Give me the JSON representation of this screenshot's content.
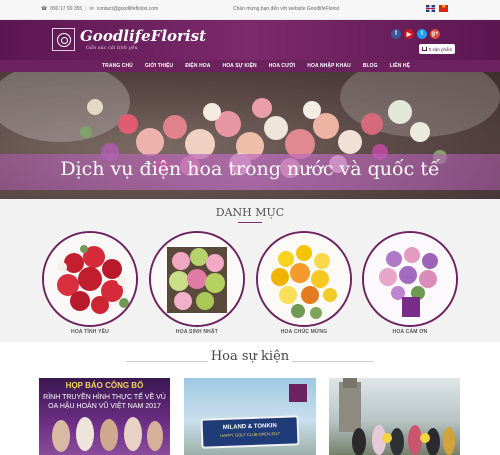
{
  "topbar": {
    "phone": "090 17 99 355",
    "separator": "|",
    "email": "contact@goodlifeflorist.com",
    "welcome": "Chào mừng bạn đến với website GoodlifeFlorist",
    "languages": [
      "English",
      "Tiếng Việt"
    ]
  },
  "header": {
    "brand": "GoodlifeFlorist",
    "tagline": "Gắn súc cải tinh yêu",
    "socials": [
      {
        "name": "facebook",
        "glyph": "f"
      },
      {
        "name": "youtube",
        "glyph": "▶"
      },
      {
        "name": "twitter",
        "glyph": "t"
      },
      {
        "name": "google-plus",
        "glyph": "g+"
      }
    ],
    "cart_label": "0 sản phẩm"
  },
  "nav": {
    "items": [
      "TRANG CHỦ",
      "GIỚI THIỆU",
      "ĐIỆN HOA",
      "HOA SỰ KIỆN",
      "HOA CƯỚI",
      "HOA NHẬP KHẨU",
      "BLOG",
      "LIÊN HỆ"
    ]
  },
  "banner": {
    "caption": "Dịch vụ điện hoa trong nước và quốc tế"
  },
  "categories": {
    "title": "DANH MỤC",
    "items": [
      {
        "label": "HOA TÌNH YÊU"
      },
      {
        "label": "HOA SINH NHẬT"
      },
      {
        "label": "HOA CHÚC MỪNG"
      },
      {
        "label": "HOA CẢM ƠN"
      }
    ]
  },
  "events": {
    "title": "Hoa sự kiện",
    "card1": {
      "line1": "HỌP BÁO CÔNG BỐ",
      "line2": "RÌNH TRUYỀN HÌNH THỰC TẾ VỀ VÙ",
      "line3": "OA HẬU HOÀN VŨ VIỆT NAM 2017"
    },
    "card2": {
      "sign_title": "MILAND & TONKIN",
      "sign_sub": "HAPPY GOLF CLUB OPEN 2017"
    }
  },
  "colors": {
    "brand_purple": "#6d2260",
    "header_purple": "#7c2a6c",
    "banner_strip": "#b46eb4"
  }
}
